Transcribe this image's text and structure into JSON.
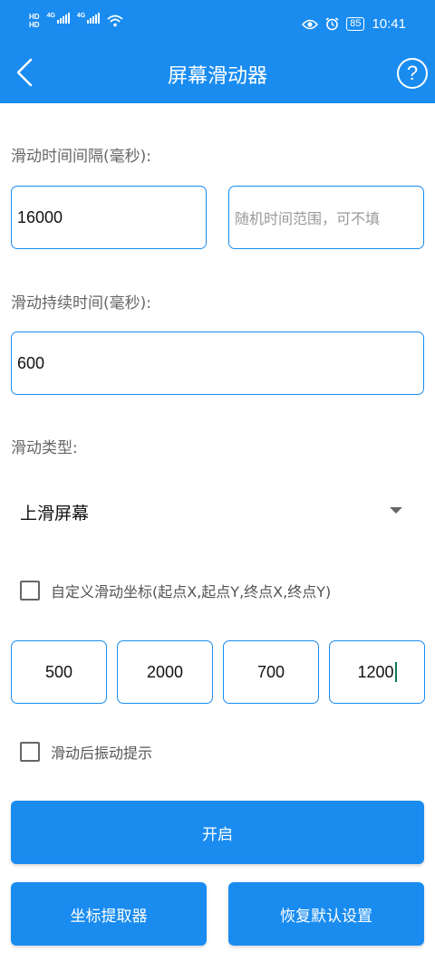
{
  "colors": {
    "primary": "#1a8cf0",
    "label": "#666666",
    "placeholder": "#999999"
  },
  "status_bar": {
    "hd1": "HD",
    "hd2": "HD",
    "net1": "4G",
    "net2": "4G",
    "battery": "85",
    "time": "10:41",
    "icons": [
      "wifi-icon",
      "eye-icon",
      "alarm-icon"
    ]
  },
  "header": {
    "title": "屏幕滑动器",
    "back_icon": "back-arrow-icon",
    "help_label": "?"
  },
  "interval": {
    "label": "滑动时间间隔(毫秒):",
    "value": "16000",
    "random_placeholder": "随机时间范围，可不填"
  },
  "duration": {
    "label": "滑动持续时间(毫秒):",
    "value": "600"
  },
  "swipe_type": {
    "label": "滑动类型:",
    "selected": "上滑屏幕"
  },
  "custom_coords": {
    "label": "自定义滑动坐标(起点X,起点Y,终点X,终点Y)",
    "checked": false,
    "start_x": "500",
    "start_y": "2000",
    "end_x": "700",
    "end_y": "1200"
  },
  "vibrate": {
    "label": "滑动后振动提示",
    "checked": false
  },
  "buttons": {
    "start": "开启",
    "coord_picker": "坐标提取器",
    "restore": "恢复默认设置"
  }
}
